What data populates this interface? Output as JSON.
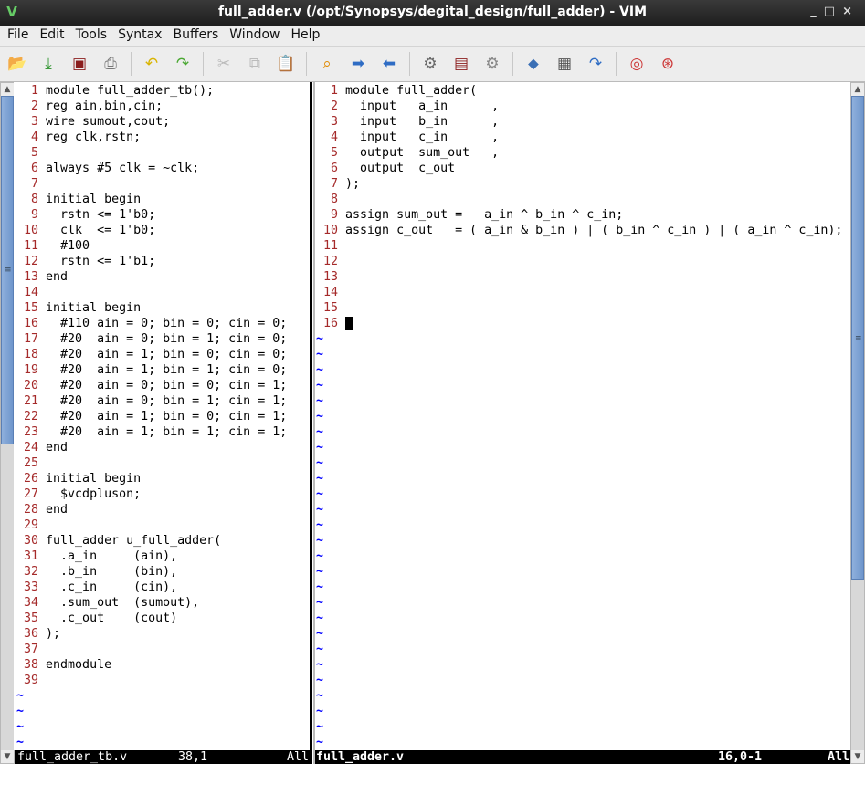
{
  "window": {
    "title": "full_adder.v (/opt/Synopsys/degital_design/full_adder) - VIM",
    "controls": [
      "_",
      "□",
      "×"
    ]
  },
  "menu": [
    "File",
    "Edit",
    "Tools",
    "Syntax",
    "Buffers",
    "Window",
    "Help"
  ],
  "toolbar": [
    {
      "name": "open-icon",
      "glyph": "📂",
      "color": "#3a6fb5"
    },
    {
      "name": "save-icon",
      "glyph": "⤓",
      "color": "#3c9a3c"
    },
    {
      "name": "save-all-icon",
      "glyph": "▣",
      "color": "#8b1c1c"
    },
    {
      "name": "print-icon",
      "glyph": "⎙",
      "color": "#777"
    },
    "sep",
    {
      "name": "undo-icon",
      "glyph": "↶",
      "color": "#d9b400"
    },
    {
      "name": "redo-icon",
      "glyph": "↷",
      "color": "#4aa832"
    },
    "sep",
    {
      "name": "cut-icon",
      "glyph": "✂",
      "color": "#bbb"
    },
    {
      "name": "copy-icon",
      "glyph": "⧉",
      "color": "#bbb"
    },
    {
      "name": "paste-icon",
      "glyph": "📋",
      "color": "#a57a2a"
    },
    "sep",
    {
      "name": "find-replace-icon",
      "glyph": "⌕",
      "color": "#e08a00"
    },
    {
      "name": "find-next-icon",
      "glyph": "➡",
      "color": "#2e6cc4"
    },
    {
      "name": "find-prev-icon",
      "glyph": "⬅",
      "color": "#2e6cc4"
    },
    "sep",
    {
      "name": "load-session-icon",
      "glyph": "⚙",
      "color": "#666"
    },
    {
      "name": "save-session-icon",
      "glyph": "▤",
      "color": "#8b1c1c"
    },
    {
      "name": "run-script-icon",
      "glyph": "⚙",
      "color": "#888"
    },
    "sep",
    {
      "name": "make-icon",
      "glyph": "⬥",
      "color": "#3a6fb5"
    },
    {
      "name": "build-tags-icon",
      "glyph": "▦",
      "color": "#555"
    },
    {
      "name": "jump-tag-icon",
      "glyph": "↷",
      "color": "#2e6cc4"
    },
    "sep",
    {
      "name": "help-icon",
      "glyph": "◎",
      "color": "#c33"
    },
    {
      "name": "find-help-icon",
      "glyph": "⊛",
      "color": "#c33"
    }
  ],
  "left": {
    "lines": [
      "module full_adder_tb();",
      "reg ain,bin,cin;",
      "wire sumout,cout;",
      "reg clk,rstn;",
      "",
      "always #5 clk = ~clk;",
      "",
      "initial begin",
      "  rstn <= 1'b0;",
      "  clk  <= 1'b0;",
      "  #100",
      "  rstn <= 1'b1;",
      "end",
      "",
      "initial begin",
      "  #110 ain = 0; bin = 0; cin = 0;",
      "  #20  ain = 0; bin = 1; cin = 0;",
      "  #20  ain = 1; bin = 0; cin = 0;",
      "  #20  ain = 1; bin = 1; cin = 0;",
      "  #20  ain = 0; bin = 0; cin = 1;",
      "  #20  ain = 0; bin = 1; cin = 1;",
      "  #20  ain = 1; bin = 0; cin = 1;",
      "  #20  ain = 1; bin = 1; cin = 1;",
      "end",
      "",
      "initial begin",
      "  $vcdpluson;",
      "end",
      "",
      "full_adder u_full_adder(",
      "  .a_in     (ain),",
      "  .b_in     (bin),",
      "  .c_in     (cin),",
      "  .sum_out  (sumout),",
      "  .c_out    (cout)",
      ");",
      "",
      "endmodule",
      ""
    ],
    "tildes": 4,
    "status": {
      "file": "full_adder_tb.v",
      "pos": "38,1",
      "scroll": "All"
    }
  },
  "right": {
    "lines": [
      "module full_adder(",
      "  input   a_in      ,",
      "  input   b_in      ,",
      "  input   c_in      ,",
      "  output  sum_out   ,",
      "  output  c_out",
      ");",
      "",
      "assign sum_out =   a_in ^ b_in ^ c_in;",
      "assign c_out   = ( a_in & b_in ) | ( b_in ^ c_in ) | ( a_in ^ c_in);",
      "",
      "",
      "",
      "",
      "",
      ""
    ],
    "cursor_line": 16,
    "tildes": 27,
    "status": {
      "file": "full_adder.v",
      "pos": "16,0-1",
      "scroll": "All"
    }
  },
  "keywords": [
    "module",
    "endmodule",
    "reg",
    "wire",
    "always",
    "initial",
    "begin",
    "end",
    "input",
    "output",
    "assign"
  ]
}
